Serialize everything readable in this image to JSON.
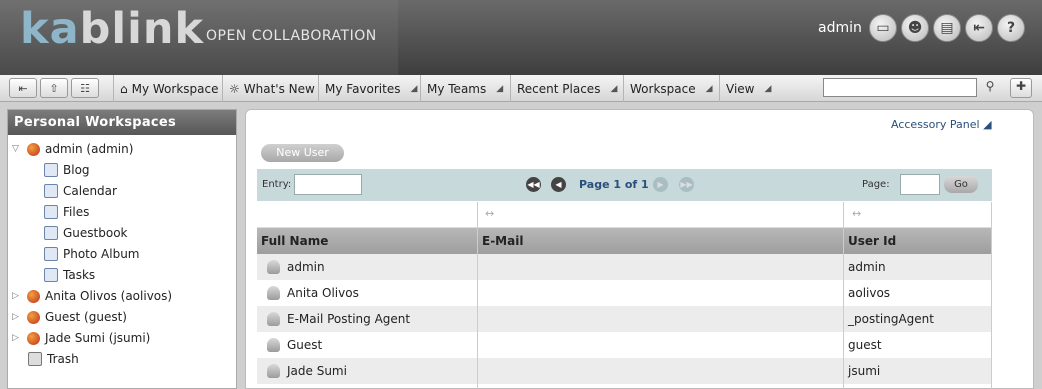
{
  "header": {
    "logo_ka": "ka",
    "logo_rest": "blink",
    "tagline": "OPEN COLLABORATION",
    "user": "admin",
    "icons": [
      "monitor-icon",
      "user-check-icon",
      "clipboard-icon",
      "logout-icon",
      "help-icon"
    ]
  },
  "nav": {
    "items": [
      {
        "label": "My Workspace",
        "menu": false
      },
      {
        "label": "What's New",
        "menu": false
      },
      {
        "label": "My Favorites",
        "menu": true
      },
      {
        "label": "My Teams",
        "menu": true
      },
      {
        "label": "Recent Places",
        "menu": true
      },
      {
        "label": "Workspace",
        "menu": true
      },
      {
        "label": "View",
        "menu": true
      }
    ],
    "search_value": ""
  },
  "sidebar": {
    "title": "Personal Workspaces",
    "tree": [
      {
        "label": "admin (admin)",
        "level": 0,
        "expanded": true
      },
      {
        "label": "Blog",
        "level": 1
      },
      {
        "label": "Calendar",
        "level": 1
      },
      {
        "label": "Files",
        "level": 1
      },
      {
        "label": "Guestbook",
        "level": 1
      },
      {
        "label": "Photo Album",
        "level": 1
      },
      {
        "label": "Tasks",
        "level": 1
      },
      {
        "label": "Anita Olivos (aolivos)",
        "level": 0,
        "expanded": false
      },
      {
        "label": "Guest (guest)",
        "level": 0,
        "expanded": false
      },
      {
        "label": "Jade Sumi (jsumi)",
        "level": 0,
        "expanded": false
      },
      {
        "label": "Trash",
        "level": 0
      }
    ]
  },
  "main": {
    "accessory_panel": "Accessory Panel",
    "new_user": "New User",
    "pager": {
      "entry_label": "Entry:",
      "entry_value": "",
      "page_info": "Page 1 of 1",
      "page_label": "Page:",
      "page_value": "",
      "go": "Go"
    },
    "table": {
      "columns": [
        "Full Name",
        "E-Mail",
        "User Id"
      ],
      "rows": [
        {
          "full_name": "admin",
          "email": "",
          "user_id": "admin"
        },
        {
          "full_name": "Anita Olivos",
          "email": "",
          "user_id": "aolivos"
        },
        {
          "full_name": "E-Mail Posting Agent",
          "email": "",
          "user_id": "_postingAgent"
        },
        {
          "full_name": "Guest",
          "email": "",
          "user_id": "guest"
        },
        {
          "full_name": "Jade Sumi",
          "email": "",
          "user_id": "jsumi"
        }
      ]
    }
  }
}
